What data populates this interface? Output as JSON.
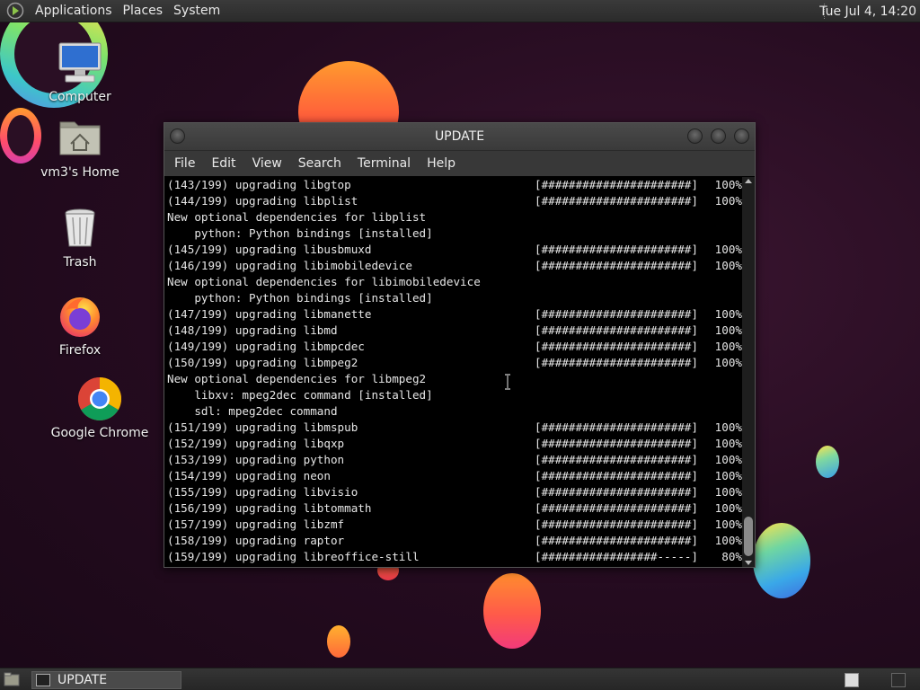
{
  "top_panel": {
    "menus": [
      "Applications",
      "Places",
      "System"
    ],
    "clock": "Tue Jul  4, 14:20"
  },
  "desktop_icons": [
    {
      "label": "Computer",
      "icon": "computer-icon"
    },
    {
      "label": "vm3's Home",
      "icon": "home-folder-icon"
    },
    {
      "label": "Trash",
      "icon": "trash-icon"
    },
    {
      "label": "Firefox",
      "icon": "firefox-icon"
    },
    {
      "label": "Google Chrome",
      "icon": "chrome-icon"
    }
  ],
  "terminal": {
    "title": "UPDATE",
    "menu": [
      "File",
      "Edit",
      "View",
      "Search",
      "Terminal",
      "Help"
    ],
    "lines": [
      {
        "text": "(143/199) upgrading libgtop",
        "bar": "[######################]",
        "pct": "100%"
      },
      {
        "text": "(144/199) upgrading libplist",
        "bar": "[######################]",
        "pct": "100%"
      },
      {
        "text": "New optional dependencies for libplist",
        "bar": "",
        "pct": ""
      },
      {
        "text": "    python: Python bindings [installed]",
        "bar": "",
        "pct": ""
      },
      {
        "text": "(145/199) upgrading libusbmuxd",
        "bar": "[######################]",
        "pct": "100%"
      },
      {
        "text": "(146/199) upgrading libimobiledevice",
        "bar": "[######################]",
        "pct": "100%"
      },
      {
        "text": "New optional dependencies for libimobiledevice",
        "bar": "",
        "pct": ""
      },
      {
        "text": "    python: Python bindings [installed]",
        "bar": "",
        "pct": ""
      },
      {
        "text": "(147/199) upgrading libmanette",
        "bar": "[######################]",
        "pct": "100%"
      },
      {
        "text": "(148/199) upgrading libmd",
        "bar": "[######################]",
        "pct": "100%"
      },
      {
        "text": "(149/199) upgrading libmpcdec",
        "bar": "[######################]",
        "pct": "100%"
      },
      {
        "text": "(150/199) upgrading libmpeg2",
        "bar": "[######################]",
        "pct": "100%"
      },
      {
        "text": "New optional dependencies for libmpeg2",
        "bar": "",
        "pct": ""
      },
      {
        "text": "    libxv: mpeg2dec command [installed]",
        "bar": "",
        "pct": ""
      },
      {
        "text": "    sdl: mpeg2dec command",
        "bar": "",
        "pct": ""
      },
      {
        "text": "(151/199) upgrading libmspub",
        "bar": "[######################]",
        "pct": "100%"
      },
      {
        "text": "(152/199) upgrading libqxp",
        "bar": "[######################]",
        "pct": "100%"
      },
      {
        "text": "(153/199) upgrading python",
        "bar": "[######################]",
        "pct": "100%"
      },
      {
        "text": "(154/199) upgrading neon",
        "bar": "[######################]",
        "pct": "100%"
      },
      {
        "text": "(155/199) upgrading libvisio",
        "bar": "[######################]",
        "pct": "100%"
      },
      {
        "text": "(156/199) upgrading libtommath",
        "bar": "[######################]",
        "pct": "100%"
      },
      {
        "text": "(157/199) upgrading libzmf",
        "bar": "[######################]",
        "pct": "100%"
      },
      {
        "text": "(158/199) upgrading raptor",
        "bar": "[######################]",
        "pct": "100%"
      },
      {
        "text": "(159/199) upgrading libreoffice-still",
        "bar": "[#################-----]",
        "pct": "80%"
      }
    ]
  },
  "taskbar": {
    "task_label": "UPDATE"
  }
}
